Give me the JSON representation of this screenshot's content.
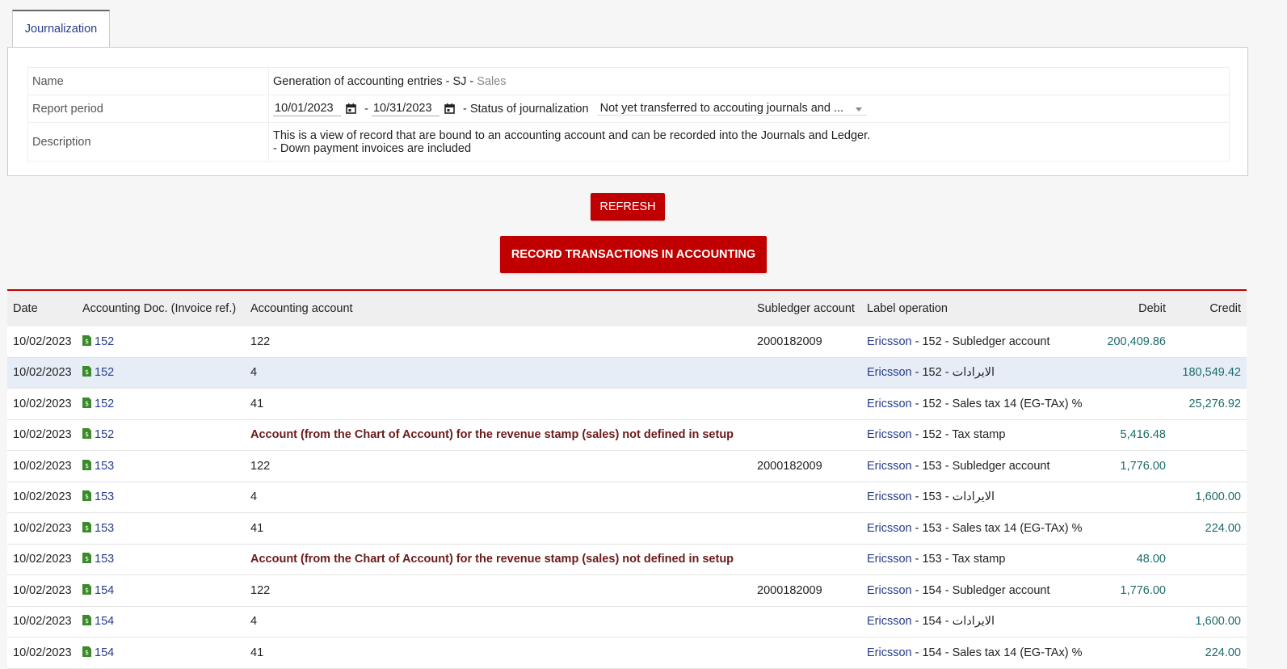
{
  "tab": {
    "label": "Journalization"
  },
  "params": {
    "name_label": "Name",
    "name_value": "Generation of accounting entries - SJ -",
    "name_muted": "Sales",
    "period_label": "Report period",
    "date_from": "10/01/2023",
    "date_sep": "-",
    "date_to": "10/31/2023",
    "status_label": "- Status of journalization",
    "status_value": "Not yet transferred to accouting journals and ...",
    "description_label": "Description",
    "description_line1": "This is a view of record that are bound to an accounting account and can be recorded into the Journals and Ledger.",
    "description_line2": "- Down payment invoices are included"
  },
  "buttons": {
    "refresh": "REFRESH",
    "record": "RECORD TRANSACTIONS IN ACCOUNTING"
  },
  "colors": {
    "accent": "#c00000",
    "link": "#263c8c",
    "money": "#1d6b6b",
    "doc_icon": "#3a8a2a"
  },
  "icons": {
    "date_picker": "calendar-icon",
    "doc": "invoice-doc-icon",
    "dropdown": "chevron-down-icon"
  },
  "table": {
    "headers": [
      "Date",
      "Accounting Doc. (Invoice ref.)",
      "Accounting account",
      "Subledger account",
      "Label operation",
      "Debit",
      "Credit"
    ],
    "rows": [
      {
        "date": "10/02/2023",
        "doc": "152",
        "account": "122",
        "subledger": "2000182009",
        "label_link": "Ericsson",
        "label_rest": " - 152 - Subledger account",
        "debit": "200,409.86",
        "credit": ""
      },
      {
        "date": "10/02/2023",
        "doc": "152",
        "account": "4",
        "subledger": "",
        "label_link": "Ericsson",
        "label_rest": " - 152 - الايرادات",
        "debit": "",
        "credit": "180,549.42"
      },
      {
        "date": "10/02/2023",
        "doc": "152",
        "account": "41",
        "subledger": "",
        "label_link": "Ericsson",
        "label_rest": " - 152 - Sales tax 14 (EG-TAx) %",
        "debit": "",
        "credit": "25,276.92"
      },
      {
        "date": "10/02/2023",
        "doc": "152",
        "account": "Account (from the Chart of Account) for the revenue stamp (sales) not defined in setup",
        "subledger": "",
        "label_link": "Ericsson",
        "label_rest": " - 152 - Tax stamp",
        "debit": "5,416.48",
        "credit": ""
      },
      {
        "date": "10/02/2023",
        "doc": "153",
        "account": "122",
        "subledger": "2000182009",
        "label_link": "Ericsson",
        "label_rest": " - 153 - Subledger account",
        "debit": "1,776.00",
        "credit": ""
      },
      {
        "date": "10/02/2023",
        "doc": "153",
        "account": "4",
        "subledger": "",
        "label_link": "Ericsson",
        "label_rest": " - 153 - الايرادات",
        "debit": "",
        "credit": "1,600.00"
      },
      {
        "date": "10/02/2023",
        "doc": "153",
        "account": "41",
        "subledger": "",
        "label_link": "Ericsson",
        "label_rest": " - 153 - Sales tax 14 (EG-TAx) %",
        "debit": "",
        "credit": "224.00"
      },
      {
        "date": "10/02/2023",
        "doc": "153",
        "account": "Account (from the Chart of Account) for the revenue stamp (sales) not defined in setup",
        "subledger": "",
        "label_link": "Ericsson",
        "label_rest": " - 153 - Tax stamp",
        "debit": "48.00",
        "credit": ""
      },
      {
        "date": "10/02/2023",
        "doc": "154",
        "account": "122",
        "subledger": "2000182009",
        "label_link": "Ericsson",
        "label_rest": " - 154 - Subledger account",
        "debit": "1,776.00",
        "credit": ""
      },
      {
        "date": "10/02/2023",
        "doc": "154",
        "account": "4",
        "subledger": "",
        "label_link": "Ericsson",
        "label_rest": " - 154 - الايرادات",
        "debit": "",
        "credit": "1,600.00"
      },
      {
        "date": "10/02/2023",
        "doc": "154",
        "account": "41",
        "subledger": "",
        "label_link": "Ericsson",
        "label_rest": " - 154 - Sales tax 14 (EG-TAx) %",
        "debit": "",
        "credit": "224.00"
      }
    ]
  }
}
